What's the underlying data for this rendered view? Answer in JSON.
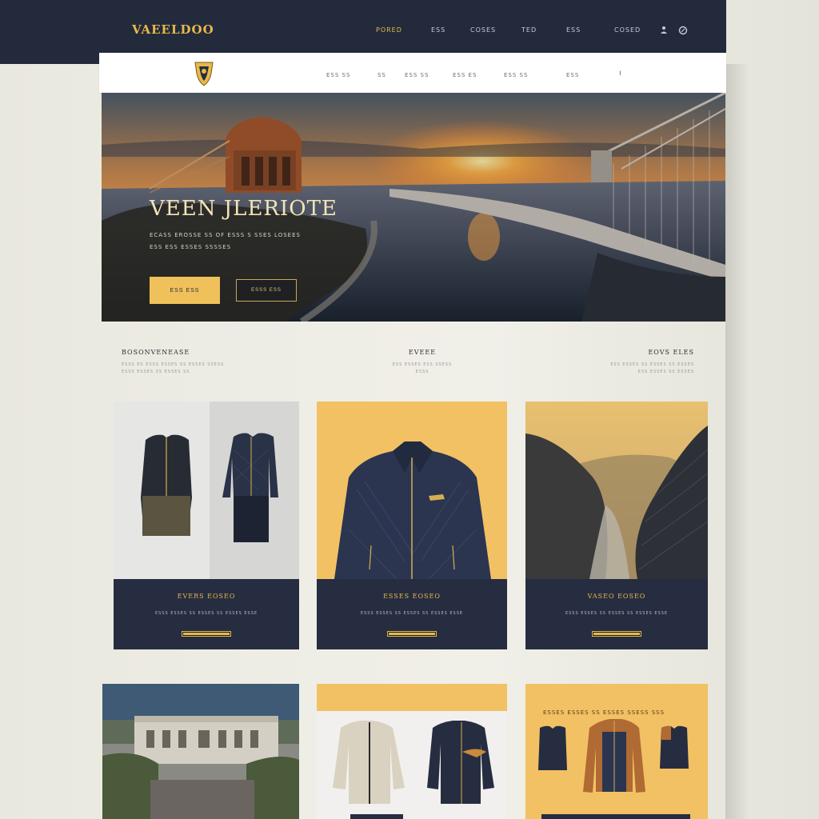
{
  "brand": {
    "logo_text": "VAEELDOO"
  },
  "top_nav": {
    "items": [
      {
        "label": "PORED",
        "active": true
      },
      {
        "label": "ESS"
      },
      {
        "label": "COSES"
      },
      {
        "label": "TED"
      },
      {
        "label": "ESS"
      },
      {
        "label": "COSED"
      }
    ],
    "icons": [
      "user-icon",
      "search-icon"
    ]
  },
  "sub_nav": {
    "items": [
      "ESS SS",
      "SS",
      "ESS SS",
      "ESS ES",
      "ESS SS",
      "ESS"
    ]
  },
  "hero": {
    "title": "VEEN JLERIOTE",
    "subtitle_line1": "ECASS EROSSE SS OF ESSS S SSES LOSEES",
    "subtitle_line2": "ESS ESS ESSES SSSSES",
    "primary_button": "ESS ESS",
    "secondary_button": "ESSS ESS"
  },
  "features": [
    {
      "title": "BOSONVENEASE",
      "line1": "ESSS ES ESSS ESSES SS ESSES SSESS",
      "line2": "ESSS ESSES SS ESSES SS"
    },
    {
      "title": "EVEEE",
      "line1": "ESS ESSES ESS SSESS",
      "line2": "ESSS"
    },
    {
      "title": "EOVS ELES",
      "line1": "ESS ESSES SS ESSES SS ESSES",
      "line2": "ESS ESSES SS ESSES"
    }
  ],
  "cards": [
    {
      "title": "EVERS EOSEO",
      "desc": "ESSS ESSES SS ESSES SS ESSES ESSE"
    },
    {
      "title": "ESSES EOSEO",
      "desc": "ESSS ESSES SS ESSES SS ESSES ESSE"
    },
    {
      "title": "VASEO EOSEO",
      "desc": "ESSS ESSES SS ESSES SS ESSES ESSE"
    }
  ],
  "bottom": {
    "banner_text": "ESSES ESSES SS ESSES SSESS SSS"
  },
  "colors": {
    "navy": "#232a3c",
    "gold": "#e8b94a",
    "mustard": "#f2c164",
    "cream": "#eeede4"
  }
}
